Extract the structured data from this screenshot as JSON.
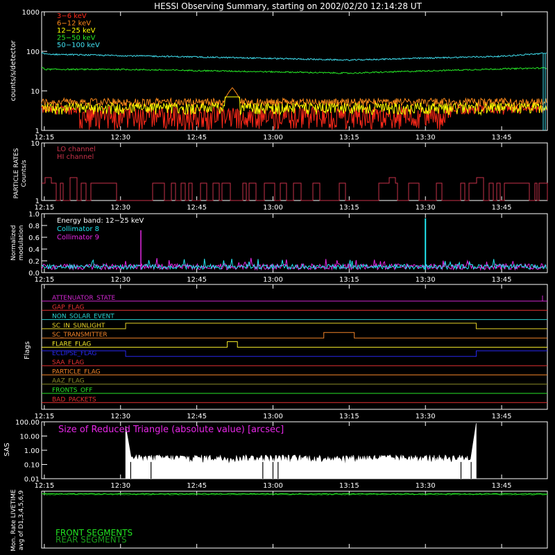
{
  "title": "HESSI Observing Summary, starting on 2002/02/20 12:14:28 UT",
  "time_ticks": [
    "12:15",
    "12:30",
    "12:45",
    "13:00",
    "13:15",
    "13:30",
    "13:45"
  ],
  "colors": {
    "3-6": "#ff2a1a",
    "6-12": "#ff8a1a",
    "12-25": "#ffff00",
    "25-50": "#26e826",
    "50-100": "#40e0f0",
    "particle": "#c8324a",
    "coll8": "#22e6f0",
    "coll9": "#e628e6",
    "sas": "#e628e6",
    "front": "#22e622",
    "rear": "#1a9e1a"
  },
  "chart_data": [
    {
      "type": "line",
      "panel": "count_rates",
      "ylabel": "counts/s/detector",
      "yscale": "log",
      "ylim": [
        1,
        1000
      ],
      "ytick_labels": [
        "1000",
        "100",
        "10",
        "1"
      ],
      "x_range_utc": [
        "12:15",
        "13:54"
      ],
      "series": [
        {
          "name": "3−6 keV",
          "approx_level": 3,
          "note_values": "noisy 1–5"
        },
        {
          "name": "6−12 keV",
          "approx_level": 5,
          "peak": {
            "t": "12:52",
            "value": 12
          }
        },
        {
          "name": "12−25 keV",
          "approx_level": 3.5
        },
        {
          "name": "25−50 keV",
          "values_by_time": [
            [
              "12:15",
              35
            ],
            [
              "12:30",
              35
            ],
            [
              "13:15",
              28
            ],
            [
              "13:45",
              36
            ],
            [
              "13:54",
              38
            ]
          ]
        },
        {
          "name": "50−100 keV",
          "values_by_time": [
            [
              "12:15",
              85
            ],
            [
              "12:30",
              78
            ],
            [
              "13:15",
              60
            ],
            [
              "13:45",
              75
            ],
            [
              "13:54",
              90
            ]
          ]
        }
      ]
    },
    {
      "type": "line",
      "panel": "particle_rates",
      "ylabel": "PARTICLE RATES\nCounts/s",
      "yscale": "log",
      "ylim": [
        1,
        10
      ],
      "ytick_labels": [
        "10",
        "1"
      ],
      "series": [
        {
          "name": "LO channel"
        },
        {
          "name": "HI channel",
          "levels": [
            1,
            2
          ]
        }
      ]
    },
    {
      "type": "line",
      "panel": "modulation",
      "ylabel": "Normalized\nmodulation",
      "ylim": [
        0,
        1
      ],
      "ytick_labels": [
        "0.0",
        "0.2",
        "0.4",
        "0.6",
        "0.8",
        "1.0"
      ],
      "energy_band": "Energy band: 12−25 keV",
      "series": [
        {
          "name": "Collimator 8",
          "baseline": 0.1,
          "spike": {
            "t": "13:30",
            "value": 0.92
          }
        },
        {
          "name": "Collimator 9",
          "baseline": 0.1,
          "spike": {
            "t": "12:34",
            "value": 0.72
          }
        }
      ]
    },
    {
      "type": "step",
      "panel": "flags",
      "ylabel": "Flags",
      "flags": [
        {
          "name": "ATTENUATOR_STATE",
          "color": "#d228d2"
        },
        {
          "name": "GAP_FLAG",
          "color": "#e83232"
        },
        {
          "name": "NON_SOLAR_EVENT",
          "color": "#28d2d2"
        },
        {
          "name": "SC_IN_SUNLIGHT",
          "color": "#e6d228",
          "high": [
            [
              "12:31",
              "13:40"
            ]
          ]
        },
        {
          "name": "SC_TRANSMITTER",
          "color": "#f08228",
          "high": [
            [
              "13:10",
              "13:16"
            ]
          ]
        },
        {
          "name": "FLARE_FLAG",
          "color": "#f0e628",
          "high": [
            [
              "12:51",
              "12:53"
            ]
          ]
        },
        {
          "name": "ECLIPSE_FLAG",
          "color": "#2828f0",
          "high_outside": [
            [
              "12:31",
              "13:40"
            ]
          ]
        },
        {
          "name": "SAA_FLAG",
          "color": "#e63232"
        },
        {
          "name": "PARTICLE_FLAG",
          "color": "#f08228"
        },
        {
          "name": "AAZ_FLAG",
          "color": "#8c8c28"
        },
        {
          "name": "FRONTS_OFF",
          "color": "#28e628"
        },
        {
          "name": "BAD_PACKETS",
          "color": "#e63232"
        }
      ]
    },
    {
      "type": "area",
      "panel": "sas",
      "ylabel": "SAS",
      "yscale": "log",
      "ylim": [
        0.01,
        100
      ],
      "ytick_labels": [
        "100.00",
        "10.00",
        "1.00",
        "0.10",
        "0.01"
      ],
      "series": [
        {
          "name": "Size of Reduced Triangle (absolute value) [arcsec]",
          "active": [
            "12:31",
            "13:40"
          ],
          "approx_level": 0.3
        }
      ]
    },
    {
      "type": "line",
      "panel": "livetime",
      "ylabel": "Mon. Rate LIVETIME\navg of D1,3,4,5,6,9",
      "series": [
        {
          "name": "FRONT SEGMENTS",
          "approx_level": 1.0
        },
        {
          "name": "REAR SEGMENTS",
          "approx_level": 1.0
        }
      ]
    }
  ]
}
